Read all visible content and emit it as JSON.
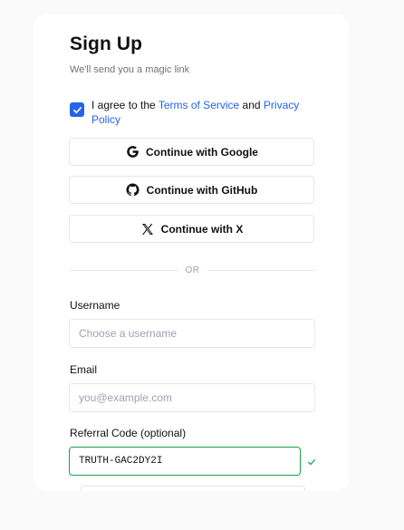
{
  "form": {
    "title": "Sign Up",
    "subtitle": "We'll send you a magic link",
    "consent": {
      "checked": true,
      "prefix": "I agree to the ",
      "terms_link": "Terms of Service",
      "conjunction": " and ",
      "privacy_link": "Privacy Policy"
    },
    "oauth": {
      "google_label": "Continue with Google",
      "github_label": "Continue with GitHub",
      "x_label": "Continue with X"
    },
    "divider_label": "OR",
    "username": {
      "label": "Username",
      "placeholder": "Choose a username",
      "value": ""
    },
    "email": {
      "label": "Email",
      "placeholder": "you@example.com",
      "value": ""
    },
    "referral": {
      "label": "Referral Code (optional)",
      "value": "TRUTH-GAC2DY2I",
      "status": "valid"
    }
  },
  "colors": {
    "accent": "#2563eb",
    "valid": "#16a34a",
    "muted": "#6b7280",
    "border": "#e5e7eb"
  },
  "icons": {
    "google": "google-icon",
    "github": "github-icon",
    "x": "x-icon",
    "checkbox": "checkmark-icon",
    "valid": "checkmark-icon"
  }
}
